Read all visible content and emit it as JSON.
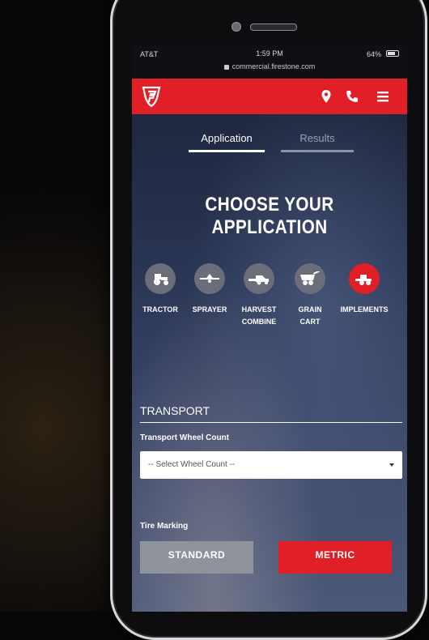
{
  "status_bar": {
    "carrier": "AT&T",
    "time": "1:59 PM",
    "battery": "64%",
    "url": "commercial.firestone.com"
  },
  "header": {
    "logo_icon": "firestone-f-logo",
    "brand_color": "#e01f26",
    "icons": [
      "location-pin-icon",
      "phone-icon",
      "menu-icon"
    ]
  },
  "tabs": [
    {
      "label": "Application",
      "active": true
    },
    {
      "label": "Results",
      "active": false
    }
  ],
  "heading": "CHOOSE YOUR APPLICATION",
  "applications": [
    {
      "label": "TRACTOR",
      "icon": "tractor-icon",
      "active": false
    },
    {
      "label": "SPRAYER",
      "icon": "sprayer-icon",
      "active": false
    },
    {
      "label": "HARVEST\nCOMBINE",
      "icon": "combine-icon",
      "active": false
    },
    {
      "label": "GRAIN\nCART",
      "icon": "grain-cart-icon",
      "active": false
    },
    {
      "label": "IMPLEMENTS",
      "icon": "implement-icon",
      "active": true
    }
  ],
  "transport": {
    "section_title": "TRANSPORT",
    "wheel_count_label": "Transport Wheel Count",
    "wheel_count_value": "-- Select Wheel Count --"
  },
  "tire_marking": {
    "label": "Tire Marking",
    "standard_label": "STANDARD",
    "metric_label": "METRIC",
    "selected": "METRIC"
  }
}
